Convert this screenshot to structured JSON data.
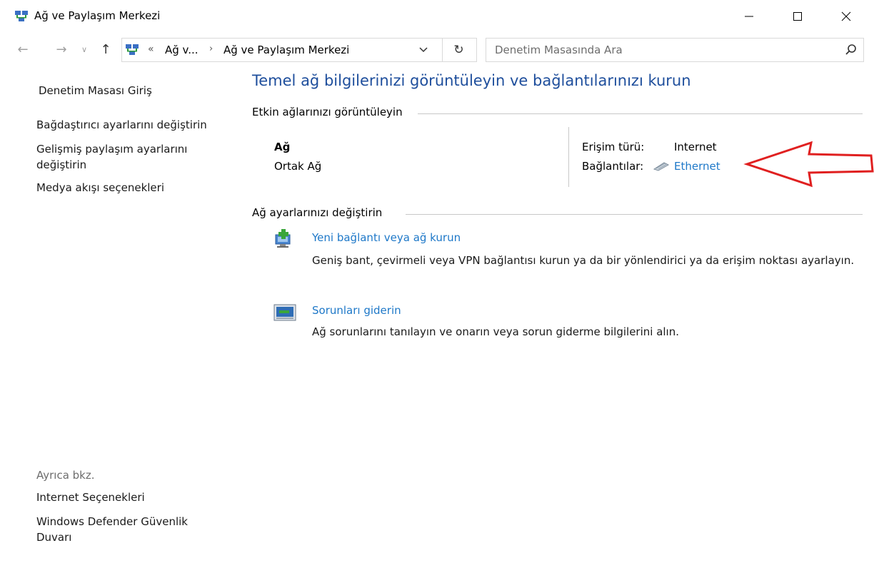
{
  "window": {
    "title": "Ağ ve Paylaşım Merkezi"
  },
  "address_bar": {
    "overflow": "«",
    "crumb1": "Ağ v...",
    "separator": "›",
    "crumb2": "Ağ ve Paylaşım Merkezi"
  },
  "search": {
    "placeholder": "Denetim Masasında Ara"
  },
  "sidebar": {
    "home": "Denetim Masası Giriş",
    "adapter_settings": "Bağdaştırıcı ayarlarını değiştirin",
    "advanced_sharing": "Gelişmiş paylaşım ayarlarını değiştirin",
    "media_streaming": "Medya akışı seçenekleri",
    "see_also": "Ayrıca bkz.",
    "internet_options": "Internet Seçenekleri",
    "defender_firewall": "Windows Defender Güvenlik Duvarı"
  },
  "main": {
    "title": "Temel ağ bilgilerinizi görüntüleyin ve bağlantılarınızı kurun",
    "active_networks_heading": "Etkin ağlarınızı görüntüleyin",
    "network_name": "Ağ",
    "network_type": "Ortak Ağ",
    "access_type_label": "Erişim türü:",
    "access_type_value": "Internet",
    "connections_label": "Bağlantılar:",
    "connection_link": "Ethernet",
    "change_settings_heading": "Ağ ayarlarınızı değiştirin",
    "tasks": [
      {
        "link": "Yeni bağlantı veya ağ kurun",
        "description": "Geniş bant, çevirmeli veya VPN bağlantısı kurun ya da bir yönlendirici ya da erişim noktası ayarlayın.",
        "icon": "new-connection-icon"
      },
      {
        "link": "Sorunları giderin",
        "description": "Ağ sorunlarını tanılayın ve onarın veya sorun giderme bilgilerini alın.",
        "icon": "troubleshoot-icon"
      }
    ]
  },
  "annotation": {
    "arrow_color": "#e02020",
    "icon": "red-arrow-icon"
  }
}
